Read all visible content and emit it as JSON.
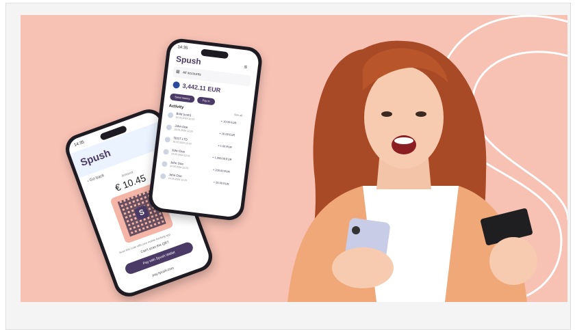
{
  "brand": {
    "name": "Spush",
    "accent": "#4b3a66",
    "hero_bg": "#f7c1b4"
  },
  "phone_left": {
    "time": "14:35",
    "back_label": "Go back",
    "amount_label": "Amount",
    "amount": "€ 10.45",
    "qr_letter": "S",
    "qr_hint": "Scan this code with your mobile banking app",
    "cant_scan": "Can't scan the QR?",
    "pay_button": "Pay with Spush Wallet",
    "url": "pay.spush.com"
  },
  "phone_right": {
    "time": "14:35",
    "accounts_label": "All accounts",
    "balance": "3,442.11 EUR",
    "send_button": "Send money",
    "pay_button": "Pay in",
    "activity_title": "Activity",
    "see_all": "See all",
    "transactions": [
      {
        "name": "Bold (com)",
        "date": "24.05.2024 12:23",
        "amount": "+ 10.00 EUR"
      },
      {
        "name": "John Doe",
        "date": "24.05.2024 12:23",
        "amount": "+ 10.00 EUR"
      },
      {
        "name": "TEST LTD",
        "date": "24.05.2024 12:23",
        "amount": "+ 1.00 EUR"
      },
      {
        "name": "John Doe",
        "date": "24.05.2024 12:23",
        "amount": "+ 1,000.00 EUR"
      },
      {
        "name": "John Doe",
        "date": "24.05.2024 12:23",
        "amount": "+ 200.00 EUR"
      },
      {
        "name": "John Doe",
        "date": "24.05.2024 12:23",
        "amount": "+ 50.00 EUR"
      }
    ]
  }
}
